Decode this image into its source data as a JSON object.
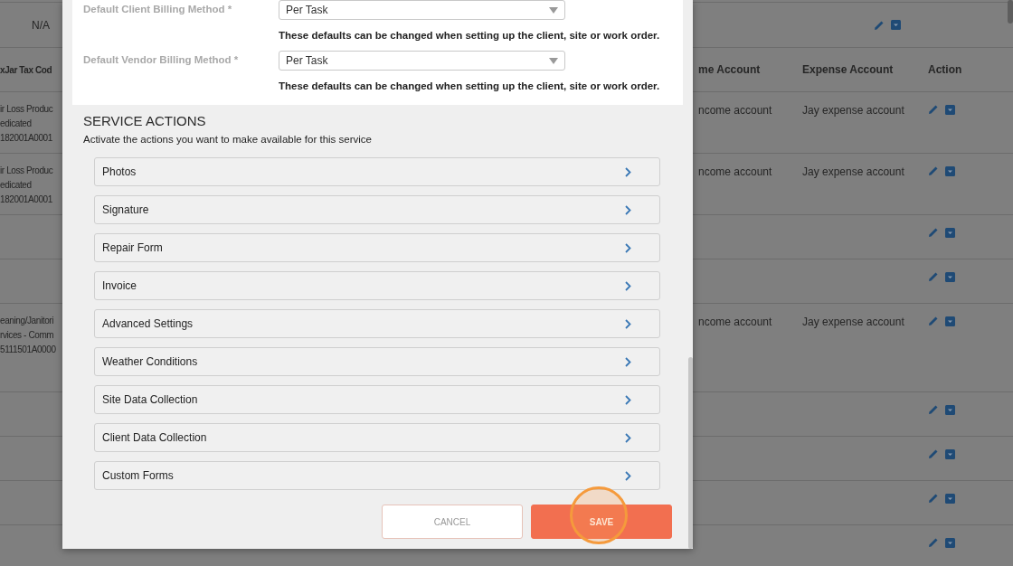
{
  "background_table": {
    "summary_row": {
      "column_1": "N/A"
    },
    "columns": [
      "xJar Tax Cod",
      "me Account",
      "Expense Account",
      "Action"
    ],
    "rows": [
      {
        "tax_code": [
          "ir Loss Produc",
          "edicated",
          "182001A0001"
        ],
        "income_account": "ncome account",
        "expense_account": "Jay expense account"
      },
      {
        "tax_code": [
          "ir Loss Produc",
          "edicated",
          "182001A0001"
        ],
        "income_account": "ncome account",
        "expense_account": "Jay expense account"
      },
      {
        "tax_code": [],
        "income_account": "",
        "expense_account": ""
      },
      {
        "tax_code": [],
        "income_account": "",
        "expense_account": ""
      },
      {
        "tax_code": [
          "eaning/Janitori",
          "rvices - Comm",
          "5111501A0000"
        ],
        "income_account": "ncome account",
        "expense_account": "Jay expense account"
      },
      {
        "tax_code": [],
        "income_account": "",
        "expense_account": ""
      },
      {
        "tax_code": [],
        "income_account": "",
        "expense_account": ""
      },
      {
        "tax_code": [],
        "income_account": "",
        "expense_account": ""
      },
      {
        "tax_code": [],
        "income_account": "",
        "expense_account": ""
      }
    ]
  },
  "modal": {
    "billing_fields": [
      {
        "label": "Default Client Billing Method *",
        "value": "Per Task",
        "note": "These defaults can be changed when setting up the client, site or work order."
      },
      {
        "label": "Default Vendor Billing Method *",
        "value": "Per Task",
        "note": "These defaults can be changed when setting up the client, site or work order."
      }
    ],
    "service_actions": {
      "title": "SERVICE ACTIONS",
      "subtitle": "Activate the actions you want to make available for this service",
      "items": [
        "Photos",
        "Signature",
        "Repair Form",
        "Invoice",
        "Advanced Settings",
        "Weather Conditions",
        "Site Data Collection",
        "Client Data Collection",
        "Custom Forms"
      ]
    },
    "buttons": {
      "cancel": "CANCEL",
      "save": "SAVE"
    }
  }
}
